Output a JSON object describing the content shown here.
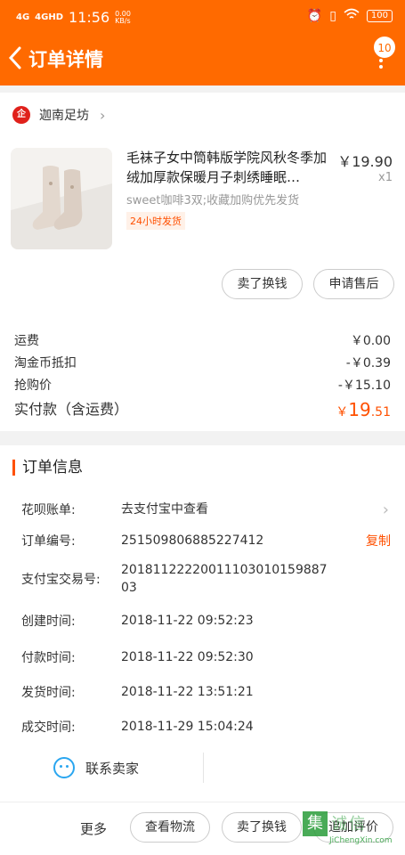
{
  "status": {
    "signal1": "4G",
    "signal2": "4GHD",
    "time": "11:56",
    "speed_value": "0.00",
    "speed_unit": "KB/s",
    "battery": "100"
  },
  "nav": {
    "title": "订单详情",
    "badge": "10"
  },
  "shop": {
    "logo": "企",
    "name": "迦南足坊"
  },
  "product": {
    "title": "毛袜子女中筒韩版学院风秋冬季加绒加厚款保暖月子刺绣睡眠…",
    "price": "￥19.90",
    "qty": "x1",
    "sku": "sweet咖啡3双;收藏加购优先发货",
    "tag": "24小时发货",
    "btn_exchange": "卖了换钱",
    "btn_aftersale": "申请售后"
  },
  "fees": [
    {
      "label": "运费",
      "value": "￥0.00"
    },
    {
      "label": "淘金币抵扣",
      "value": "-￥0.39"
    },
    {
      "label": "抢购价",
      "value": "-￥15.10"
    }
  ],
  "total": {
    "label": "实付款（含运费）",
    "currency": "￥",
    "int": "19",
    "dec": ".51"
  },
  "order_info": {
    "title": "订单信息",
    "huabei_label": "花呗账单:",
    "huabei_value": "去支付宝中查看",
    "order_no_label": "订单编号:",
    "order_no": "251509806885227412",
    "copy": "复制",
    "alipay_label": "支付宝交易号:",
    "alipay_no": "2018112222001110301015988703",
    "created_label": "创建时间:",
    "created": "2018-11-22 09:52:23",
    "paid_label": "付款时间:",
    "paid": "2018-11-22 09:52:30",
    "shipped_label": "发货时间:",
    "shipped": "2018-11-22 13:51:21",
    "done_label": "成交时间:",
    "done": "2018-11-29 15:04:24",
    "contact": "联系卖家"
  },
  "bottom": {
    "more": "更多",
    "logistics": "查看物流",
    "exchange": "卖了换钱",
    "review": "追加评价"
  },
  "watermark": {
    "char": "集",
    "cn": "诚信",
    "en": "JiChengXin.com"
  },
  "colors": {
    "brand": "#ff6a00",
    "accent": "#ff5000"
  }
}
